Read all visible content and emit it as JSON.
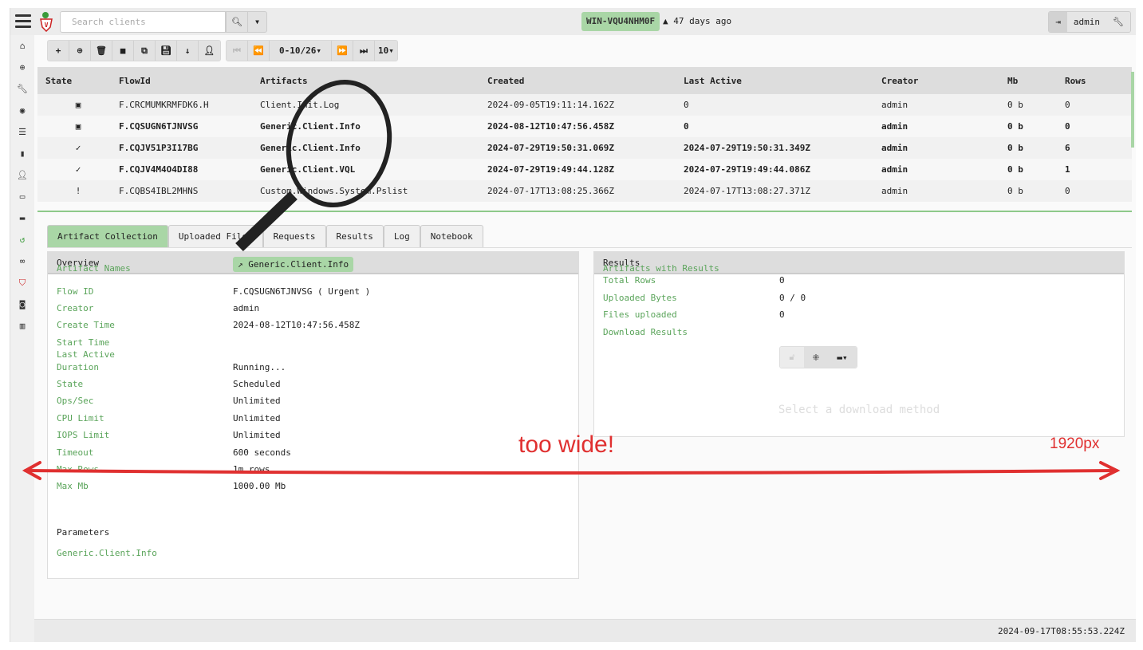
{
  "topbar": {
    "search_placeholder": "Search clients",
    "hostname": "WIN-VQU4NHM0F",
    "last_seen": "47 days ago",
    "user": "admin"
  },
  "toolbar": {
    "pager": "0-10/26",
    "page_size": "10"
  },
  "table": {
    "headers": [
      "State",
      "FlowId",
      "Artifacts",
      "Created",
      "Last Active",
      "Creator",
      "Mb",
      "Rows"
    ],
    "rows": [
      {
        "state": "scheduled",
        "state_glyph": "▣",
        "flow": "F.CRCMUMKRMFDK6.H",
        "artifact": "Client.Init.Log",
        "created": "2024-09-05T19:11:14.162Z",
        "last": "0",
        "creator": "admin",
        "mb": "0 b",
        "rows": "0",
        "bold": false
      },
      {
        "state": "scheduled",
        "state_glyph": "▣",
        "flow": "F.CQSUGN6TJNVSG",
        "artifact": "Generic.Client.Info",
        "created": "2024-08-12T10:47:56.458Z",
        "last": "0",
        "creator": "admin",
        "mb": "0 b",
        "rows": "0",
        "bold": true
      },
      {
        "state": "finished",
        "state_glyph": "✓",
        "flow": "F.CQJV51P3I17BG",
        "artifact": "Generic.Client.Info",
        "created": "2024-07-29T19:50:31.069Z",
        "last": "2024-07-29T19:50:31.349Z",
        "creator": "admin",
        "mb": "0 b",
        "rows": "6",
        "bold": true
      },
      {
        "state": "finished",
        "state_glyph": "✓",
        "flow": "F.CQJV4M4O4DI88",
        "artifact": "Generic.Client.VQL",
        "created": "2024-07-29T19:49:44.128Z",
        "last": "2024-07-29T19:49:44.086Z",
        "creator": "admin",
        "mb": "0 b",
        "rows": "1",
        "bold": true
      },
      {
        "state": "error",
        "state_glyph": "!",
        "flow": "F.CQBS4IBL2MHNS",
        "artifact": "Custom.Windows.System.Pslist",
        "created": "2024-07-17T13:08:25.366Z",
        "last": "2024-07-17T13:08:27.371Z",
        "creator": "admin",
        "mb": "0 b",
        "rows": "0",
        "bold": false
      }
    ]
  },
  "tabs": [
    "Artifact Collection",
    "Uploaded Files",
    "Requests",
    "Results",
    "Log",
    "Notebook"
  ],
  "overview": {
    "title": "Overview",
    "fields": [
      {
        "k": "Artifact Names",
        "v": "Generic.Client.Info"
      },
      {
        "k": "Flow ID",
        "v": "F.CQSUGN6TJNVSG ( Urgent )"
      },
      {
        "k": "Creator",
        "v": "admin"
      },
      {
        "k": "Create Time",
        "v": "2024-08-12T10:47:56.458Z"
      },
      {
        "k": "Start Time",
        "v": ""
      },
      {
        "k": "Last Active",
        "v": ""
      },
      {
        "k": "Duration",
        "v": "Running..."
      },
      {
        "k": "State",
        "v": "Scheduled"
      },
      {
        "k": "Ops/Sec",
        "v": "Unlimited"
      },
      {
        "k": "CPU Limit",
        "v": "Unlimited"
      },
      {
        "k": "IOPS Limit",
        "v": "Unlimited"
      },
      {
        "k": "Timeout",
        "v": "600 seconds"
      },
      {
        "k": "Max Rows",
        "v": "1m rows"
      },
      {
        "k": "Max Mb",
        "v": "1000.00 Mb"
      }
    ],
    "parameters_label": "Parameters",
    "parameters_artifact": "Generic.Client.Info"
  },
  "results": {
    "title": "Results",
    "fields": [
      {
        "k": "Artifacts with Results",
        "v": ""
      },
      {
        "k": "Total Rows",
        "v": "0"
      },
      {
        "k": "Uploaded Bytes",
        "v": "0 / 0"
      },
      {
        "k": "Files uploaded",
        "v": "0"
      },
      {
        "k": "Download Results",
        "v": ""
      }
    ],
    "placeholder": "Select a download method"
  },
  "footer": {
    "timestamp": "2024-09-17T08:55:53.224Z"
  },
  "annotation": {
    "label": "too wide!",
    "width_label": "1920px",
    "color": "#e03030"
  }
}
